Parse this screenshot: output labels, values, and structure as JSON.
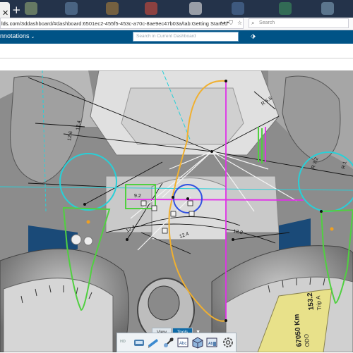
{
  "browser": {
    "tab_close_icon": "close-icon",
    "new_tab_icon": "plus-icon",
    "url_host": "lds.com",
    "url_path": "/3ddashboard/#dashboard:6501ec2-455f5-453c-a70c-8ae9ec47b03a/tab:Getting Started",
    "search_placeholder": "Search"
  },
  "app": {
    "title": "nnotations",
    "search_placeholder": "Search in Current Dashboard",
    "tag_icon": "tag-icon"
  },
  "toolbar": {
    "tabs": [
      "View",
      "Tools"
    ],
    "hd_label": "HD",
    "buttons": [
      "measure-icon",
      "section-icon",
      "ruler-icon",
      "annotation-icon",
      "cube-icon",
      "display-icon",
      "capture-icon",
      "settings-gear-icon"
    ]
  },
  "viewer": {
    "dims": [
      "R 6.8",
      "R 1",
      "12.8",
      "12.4",
      "12.6",
      "12.4",
      "12.4",
      "9.2",
      "R 3.2"
    ],
    "odo_labels": [
      "ODO",
      "Trip A"
    ],
    "odo_values": [
      "67050 Km",
      "153.2"
    ],
    "colors": {
      "cyan": "#28d0d8",
      "magenta": "#e030e8",
      "orange": "#f0b030",
      "green": "#50d040",
      "blue": "#3050e0",
      "white_lines": "#f4f4f4"
    }
  }
}
